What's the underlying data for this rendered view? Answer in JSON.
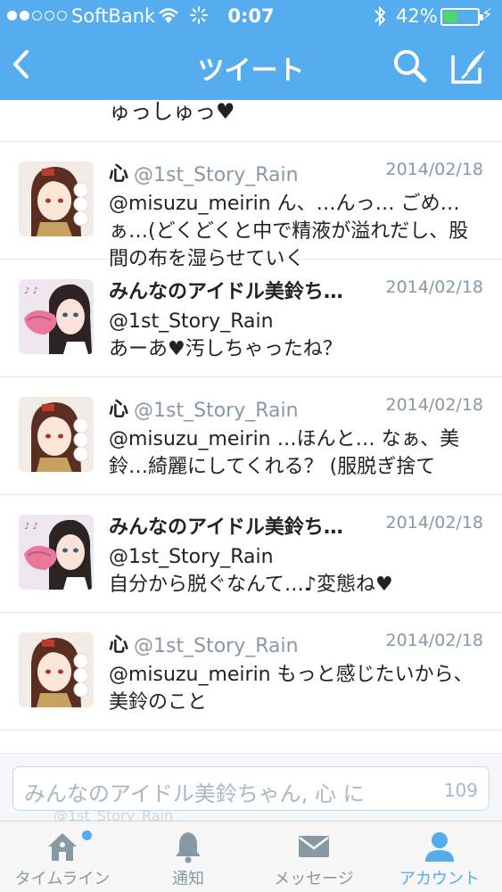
{
  "status_bar": {
    "carrier": "SoftBank",
    "time": "0:07",
    "battery_percent": "42%",
    "battery_level": 0.42,
    "signal_filled": 2
  },
  "nav": {
    "back_icon": "chevron-left-icon",
    "title": "ツイート",
    "search_icon": "search-icon",
    "compose_icon": "compose-icon"
  },
  "partial_tweet": {
    "text": "ゅっしゅっ♥"
  },
  "tweets": [
    {
      "name": "心",
      "handle": "@1st_Story_Rain",
      "date": "2014/02/18",
      "text": "@misuzu_meirin ん、…んっ… ごめ…ぁ…(どくどくと中で精液が溢れだし、股間の布を湿らせていく"
    },
    {
      "name": "みんなのアイドル美鈴ち…",
      "handle": "",
      "date": "2014/02/18",
      "text": "@1st_Story_Rain\nあーあ♥汚しちゃったね？"
    },
    {
      "name": "心",
      "handle": "@1st_Story_Rain",
      "date": "2014/02/18",
      "text": "@misuzu_meirin …ほんと… なぁ、美鈴…綺麗にしてくれる？ (服脱ぎ捨て"
    },
    {
      "name": "みんなのアイドル美鈴ち…",
      "handle": "",
      "date": "2014/02/18",
      "text": "@1st_Story_Rain\n自分から脱ぐなんて…♪変態ね♥"
    },
    {
      "name": "心",
      "handle": "@1st_Story_Rain",
      "date": "2014/02/18",
      "text": "@misuzu_meirin もっと感じたいから、美鈴のこと"
    }
  ],
  "reply": {
    "placeholder": "みんなのアイドル美鈴ちゃん, 心 に",
    "count": "109",
    "ghost_text": "@1st_Story_Rain"
  },
  "tabs": [
    {
      "label": "タイムライン",
      "icon": "home-icon",
      "badge": true,
      "active": false
    },
    {
      "label": "通知",
      "icon": "bell-icon",
      "badge": false,
      "active": false
    },
    {
      "label": "メッセージ",
      "icon": "envelope-icon",
      "badge": false,
      "active": false
    },
    {
      "label": "アカウント",
      "icon": "person-icon",
      "badge": false,
      "active": true
    }
  ],
  "colors": {
    "brand_blue": "#55acee",
    "battery_green": "#4cd964",
    "muted_gray": "#8899a6"
  }
}
